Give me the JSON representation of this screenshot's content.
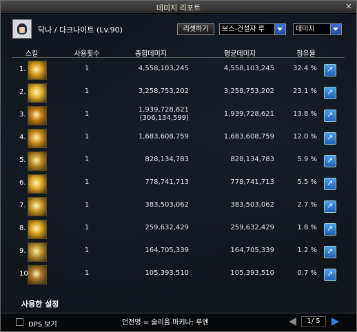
{
  "window": {
    "title": "데미지 리포트"
  },
  "character": {
    "name": "닥나 / 다크나이트 (Lv.90)"
  },
  "controls": {
    "reset_label": "리셋하기",
    "dungeon_select": "보스-건설자 루",
    "type_select": "데미지"
  },
  "table": {
    "headers": {
      "skill": "스킬",
      "uses": "사용횟수",
      "total": "종합데미지",
      "avg": "평균데미지",
      "share": "점유율"
    },
    "rows": [
      {
        "rank": "1.",
        "uses": "1",
        "total": "4,558,103,245",
        "total2": "",
        "avg": "4,558,103,245",
        "share": "32.4 %",
        "icon_color": "#d89a20"
      },
      {
        "rank": "2.",
        "uses": "1",
        "total": "3,258,753,202",
        "total2": "",
        "avg": "3,258,753,202",
        "share": "23.1 %",
        "icon_color": "#e0b030"
      },
      {
        "rank": "3.",
        "uses": "1",
        "total": "1,939,728,621",
        "total2": "(306,134,599)",
        "avg": "1,939,728,621",
        "share": "13.8 %",
        "icon_color": "#c07a18"
      },
      {
        "rank": "4.",
        "uses": "1",
        "total": "1,683,608,759",
        "total2": "",
        "avg": "1,683,608,759",
        "share": "12.0 %",
        "icon_color": "#d09020"
      },
      {
        "rank": "5.",
        "uses": "1",
        "total": "828,134,783",
        "total2": "",
        "avg": "828,134,783",
        "share": "5.9 %",
        "icon_color": "#b88a28"
      },
      {
        "rank": "6.",
        "uses": "1",
        "total": "778,741,713",
        "total2": "",
        "avg": "778,741,713",
        "share": "5.5 %",
        "icon_color": "#e0a828"
      },
      {
        "rank": "7.",
        "uses": "1",
        "total": "383,503,062",
        "total2": "",
        "avg": "383,503,062",
        "share": "2.7 %",
        "icon_color": "#c89828"
      },
      {
        "rank": "8.",
        "uses": "1",
        "total": "259,632,429",
        "total2": "",
        "avg": "259,632,429",
        "share": "1.8 %",
        "icon_color": "#d8a020"
      },
      {
        "rank": "9.",
        "uses": "1",
        "total": "164,705,339",
        "total2": "",
        "avg": "164,705,339",
        "share": "1.2 %",
        "icon_color": "#b89030"
      },
      {
        "rank": "10.",
        "uses": "1",
        "total": "105,393,510",
        "total2": "",
        "avg": "105,393,510",
        "share": "0.7 %",
        "icon_color": "#a07028"
      }
    ]
  },
  "footer": {
    "settings_label": "사용한 설정",
    "dps_label": "DPS 보기",
    "dungeon_line": "던전명 = 슬리윰 마키나: 루멘",
    "page": "1/ 5"
  }
}
